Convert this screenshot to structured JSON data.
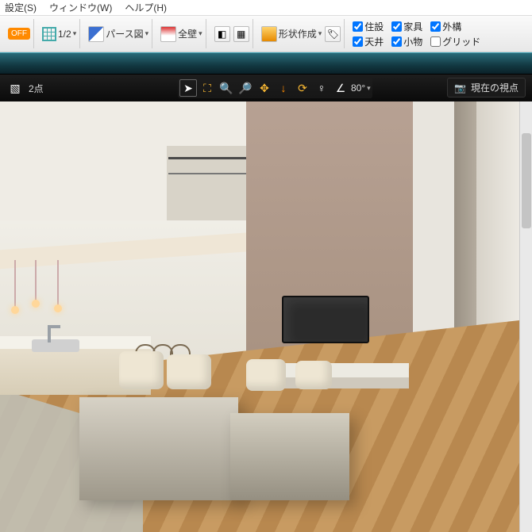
{
  "menu": {
    "item1": "設定(S)",
    "item2": "ウィンドウ(W)",
    "item3": "ヘルプ(H)"
  },
  "toolbar": {
    "snap_badge": "OFF",
    "scale": "1/2",
    "view_mode": "パース図",
    "wall_mode": "全壁",
    "shape_create": "形状作成"
  },
  "checkboxes": {
    "r1c1": {
      "label": "住設",
      "checked": true
    },
    "r1c2": {
      "label": "家具",
      "checked": true
    },
    "r1c3": {
      "label": "外構",
      "checked": true
    },
    "r2c1": {
      "label": "天井",
      "checked": true
    },
    "r2c2": {
      "label": "小物",
      "checked": true
    },
    "r2c3": {
      "label": "グリッド",
      "checked": false
    }
  },
  "secondbar": {
    "mode": "2点",
    "angle": "80°",
    "camera_label": "現在の視点"
  }
}
